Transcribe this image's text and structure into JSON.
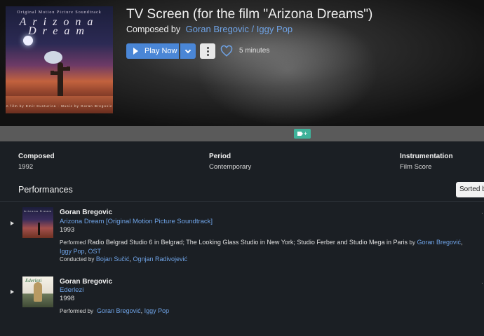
{
  "header": {
    "cover": {
      "top_text": "Original Motion Picture Soundtrack",
      "title_text": "Arizona Dream",
      "credits_text": "A film by Emir Kusturica · Music by Goran Bregovic"
    },
    "title": "TV Screen (for the film \"Arizona Dreams\")",
    "composed_by_label": "Composed by",
    "composers": "Goran Bregovic / Iggy Pop",
    "play_label": "Play Now",
    "duration": "5 minutes"
  },
  "tag_add_label": "+",
  "meta": {
    "composed_label": "Composed",
    "composed_value": "1992",
    "period_label": "Period",
    "period_value": "Contemporary",
    "instrumentation_label": "Instrumentation",
    "instrumentation_value": "Film Score"
  },
  "performances": {
    "heading": "Performances",
    "sort_label": "Sorted by",
    "items": [
      {
        "artist": "Goran Bregovic",
        "album": "Arizona Dream [Original Motion Picture Soundtrack]",
        "year": "1993",
        "performed_label": "Performed",
        "venue": "Radio Belgrad Studio 6 in Belgrad; The Looking Glass Studio in New York; Studio Ferber and Studio Mega in Paris",
        "by_label": "by",
        "performer1": "Goran Bregović",
        "performer2": "Iggy Pop",
        "performer3": "OST",
        "conducted_label": "Conducted by",
        "conductor1": "Bojan Sučić",
        "conductor2": "Ognjan Radivojević",
        "thumb_text": "Arizona Dream"
      },
      {
        "artist": "Goran Bregovic",
        "album": "Ederlezi",
        "year": "1998",
        "performed_label": "Performed by",
        "performer1": "Goran Bregović",
        "performer2": "Iggy Pop",
        "thumb_text": "Ederlezi"
      }
    ]
  },
  "colors": {
    "accent": "#4a86d6",
    "link": "#6fa3e6",
    "tag": "#3fb29a",
    "background": "#1b1f24"
  },
  "icons": [
    "play-icon",
    "chevron-down-icon",
    "more-vert-icon",
    "heart-icon",
    "tag-icon",
    "expand-triangle-icon"
  ]
}
